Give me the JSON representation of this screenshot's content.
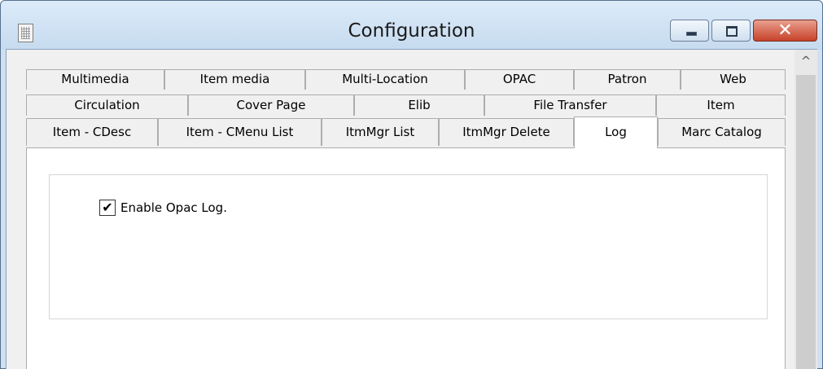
{
  "window": {
    "title": "Configuration",
    "close_glyph": "✕",
    "accent": "#c7412a"
  },
  "tabs": {
    "row1": [
      "Multimedia",
      "Item media",
      "Multi-Location",
      "OPAC",
      "Patron",
      "Web"
    ],
    "row2": [
      "Circulation",
      "Cover Page",
      "Elib",
      "File Transfer",
      "Item"
    ],
    "row3": [
      "Item - CDesc",
      "Item - CMenu List",
      "ItmMgr List",
      "ItmMgr Delete",
      "Log",
      "Marc Catalog"
    ],
    "selected": "Log"
  },
  "log": {
    "checkbox_label": "Enable Opac Log.",
    "checkbox_checked": true,
    "check_glyph": "✔"
  },
  "scrollbar": {
    "up_glyph": "^"
  },
  "icons": [
    "app-icon",
    "minimize-icon",
    "maximize-icon",
    "close-icon",
    "check-icon",
    "scroll-up-icon"
  ]
}
